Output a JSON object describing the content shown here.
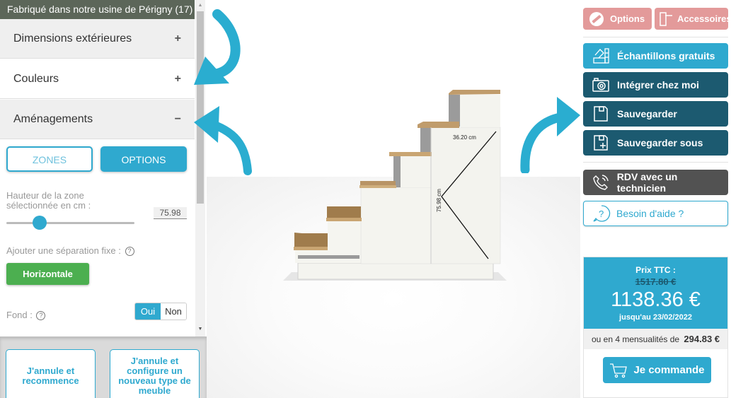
{
  "left_panel": {
    "banner": "Fabriqué dans notre usine de Périgny (17)",
    "accordion": [
      {
        "label": "Dimensions extérieures",
        "sign": "+"
      },
      {
        "label": "Couleurs",
        "sign": "+"
      },
      {
        "label": "Aménagements",
        "sign": "−"
      }
    ],
    "tabs": {
      "zones": "ZONES",
      "options": "OPTIONS",
      "active": "OPTIONS"
    },
    "height_label_line1": "Hauteur de la zone",
    "height_label_line2": "sélectionnée en cm :",
    "height_value": "75.98",
    "slider_fraction": 0.23,
    "separation_label": "Ajouter une séparation fixe :",
    "separation_button": "Horizontale",
    "fond_label": "Fond :",
    "fond_toggle": {
      "yes": "Oui",
      "no": "Non",
      "selected": "Oui"
    },
    "help_glyph": "?"
  },
  "bottom_buttons": {
    "restart": "J'annule et recommence",
    "new_type": "J'annule et configure un nouveau type de meuble"
  },
  "viewer": {
    "dimension_width": "36.20 cm",
    "dimension_height": "75.98 cm"
  },
  "right_panel": {
    "options_label": "Options",
    "accessories_label": "Accessoires",
    "samples_label": "Échantillons gratuits",
    "integrate_label": "Intégrer chez moi",
    "save_label": "Sauvegarder",
    "save_as_label": "Sauvegarder sous",
    "appointment_label": "RDV avec un technicien",
    "help_label": "Besoin d'aide ?"
  },
  "price": {
    "label": "Prix TTC :",
    "old_price": "1517.80 €",
    "new_price": "1138.36 €",
    "until": "jusqu'au 23/02/2022",
    "monthly_text": "ou en 4 mensualités de",
    "monthly_amount": "294.83 €",
    "order_label": "Je commande"
  },
  "colors": {
    "accent_blue": "#2fa9cf",
    "dark_teal": "#1c5a70",
    "pink": "#e39a9a",
    "green": "#4caf50",
    "banner": "#5c6659",
    "grey_button": "#525252"
  }
}
